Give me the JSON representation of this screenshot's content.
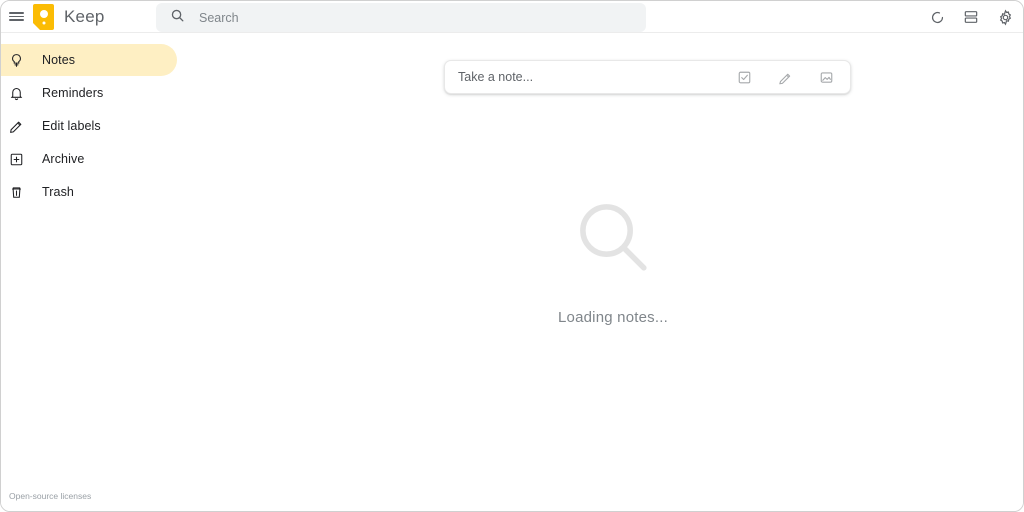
{
  "app": {
    "name": "Keep",
    "logo_color": "#fbbc04"
  },
  "header": {
    "menu_icon": "hamburger-menu-icon",
    "search": {
      "icon": "search-icon",
      "placeholder": "Search",
      "value": ""
    },
    "actions": [
      {
        "name": "refresh-icon",
        "label": "Refresh"
      },
      {
        "name": "list-view-icon",
        "label": "List view"
      },
      {
        "name": "settings-gear-icon",
        "label": "Settings"
      }
    ]
  },
  "sidebar": {
    "items": [
      {
        "label": "Notes",
        "icon": "lightbulb-icon",
        "active": true
      },
      {
        "label": "Reminders",
        "icon": "bell-icon",
        "active": false
      },
      {
        "label": "Edit labels",
        "icon": "pencil-icon",
        "active": false
      },
      {
        "label": "Archive",
        "icon": "archive-icon",
        "active": false
      },
      {
        "label": "Trash",
        "icon": "trash-icon",
        "active": false
      }
    ],
    "active_background": "#feefc3",
    "footer_link": "Open-source licenses"
  },
  "main": {
    "take_a_note": {
      "placeholder": "Take a note...",
      "actions": [
        {
          "name": "new-list-icon",
          "label": "New list"
        },
        {
          "name": "new-drawing-icon",
          "label": "New note with drawing"
        },
        {
          "name": "new-image-icon",
          "label": "New note with image"
        }
      ]
    },
    "empty_state": {
      "icon": "magnifying-glass-icon",
      "message": "Loading notes..."
    }
  }
}
